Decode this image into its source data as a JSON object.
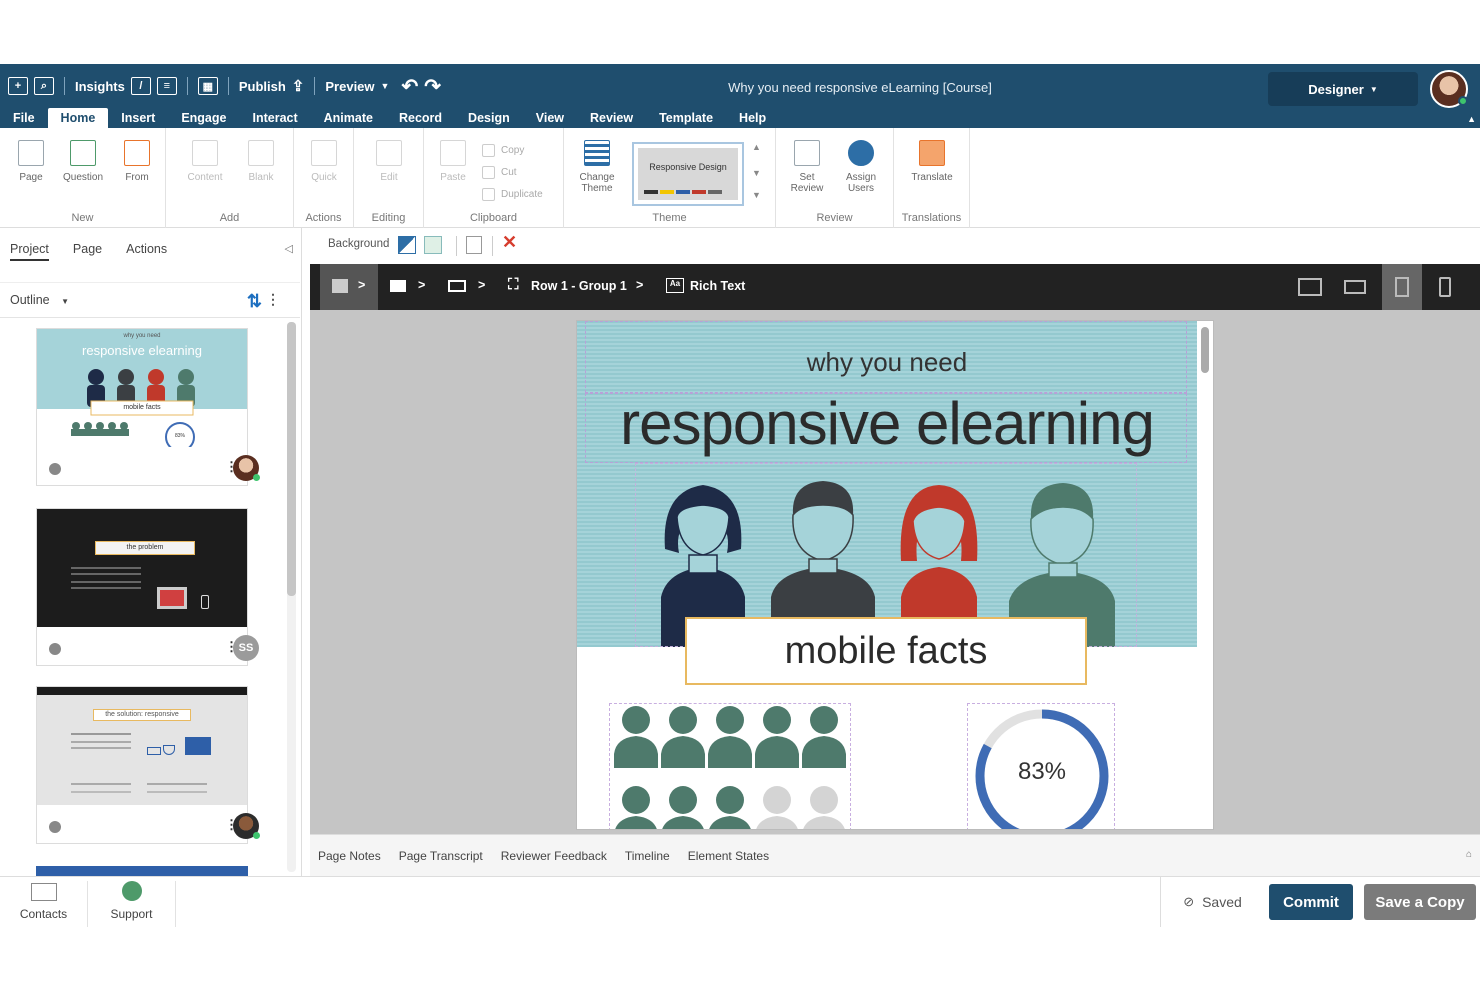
{
  "colors": {
    "brand": "#1f4e6e",
    "accent": "#1d6fc0",
    "hero_bg": "#a5d3d9",
    "persons": [
      "#1e2b47",
      "#3b3f43",
      "#c0392b",
      "#4e7a6c"
    ],
    "progress": "#3f6cb5"
  },
  "topbar": {
    "insights_label": "Insights",
    "publish_label": "Publish",
    "preview_label": "Preview",
    "title": "Why  you need responsive eLearning [Course]",
    "role_label": "Designer"
  },
  "menu": [
    "File",
    "Home",
    "Insert",
    "Engage",
    "Interact",
    "Animate",
    "Record",
    "Design",
    "View",
    "Review",
    "Template",
    "Help"
  ],
  "ribbon": {
    "new_group": "New",
    "page": "Page",
    "question": "Question",
    "from": "From",
    "add_group": "Add",
    "content": "Content",
    "blank": "Blank",
    "actions_group": "Actions",
    "quick": "Quick",
    "editing_group": "Editing",
    "edit": "Edit",
    "clipboard_group": "Clipboard",
    "paste": "Paste",
    "copy": "Copy",
    "cut": "Cut",
    "duplicate": "Duplicate",
    "theme_group": "Theme",
    "change_theme_1": "Change",
    "change_theme_2": "Theme",
    "theme_name": "Responsive Design",
    "review_group": "Review",
    "set_review_1": "Set",
    "set_review_2": "Review",
    "assign_users_1": "Assign",
    "assign_users_2": "Users",
    "translations_group": "Translations",
    "translate": "Translate"
  },
  "leftpanel": {
    "tabs": [
      "Project",
      "Page",
      "Actions"
    ],
    "outline_label": "Outline",
    "thumb1": {
      "sub": "why you need",
      "title": "responsive elearning",
      "box": "mobile facts",
      "pct": "83%"
    },
    "thumb2": {
      "box": "the problem"
    },
    "thumb3": {
      "box": "the solution: responsive"
    },
    "avatar2_initials": "SS"
  },
  "bgbar": {
    "background_label": "Background"
  },
  "breadcrumb": {
    "group": "Row 1 - Group 1",
    "element": "Rich Text"
  },
  "slide": {
    "subtitle": "why you need",
    "title": "responsive elearning",
    "box_text_1": "mobile",
    "box_text_2": "facts",
    "percent_label": "83%",
    "progress": 0.83,
    "filled_people": 8,
    "total_people": 10
  },
  "bottom_tabs": [
    "Page Notes",
    "Page Transcript",
    "Reviewer Feedback",
    "Timeline",
    "Element States"
  ],
  "footer": {
    "contacts": "Contacts",
    "support": "Support",
    "saved": "Saved",
    "commit": "Commit",
    "save_copy": "Save a Copy"
  }
}
